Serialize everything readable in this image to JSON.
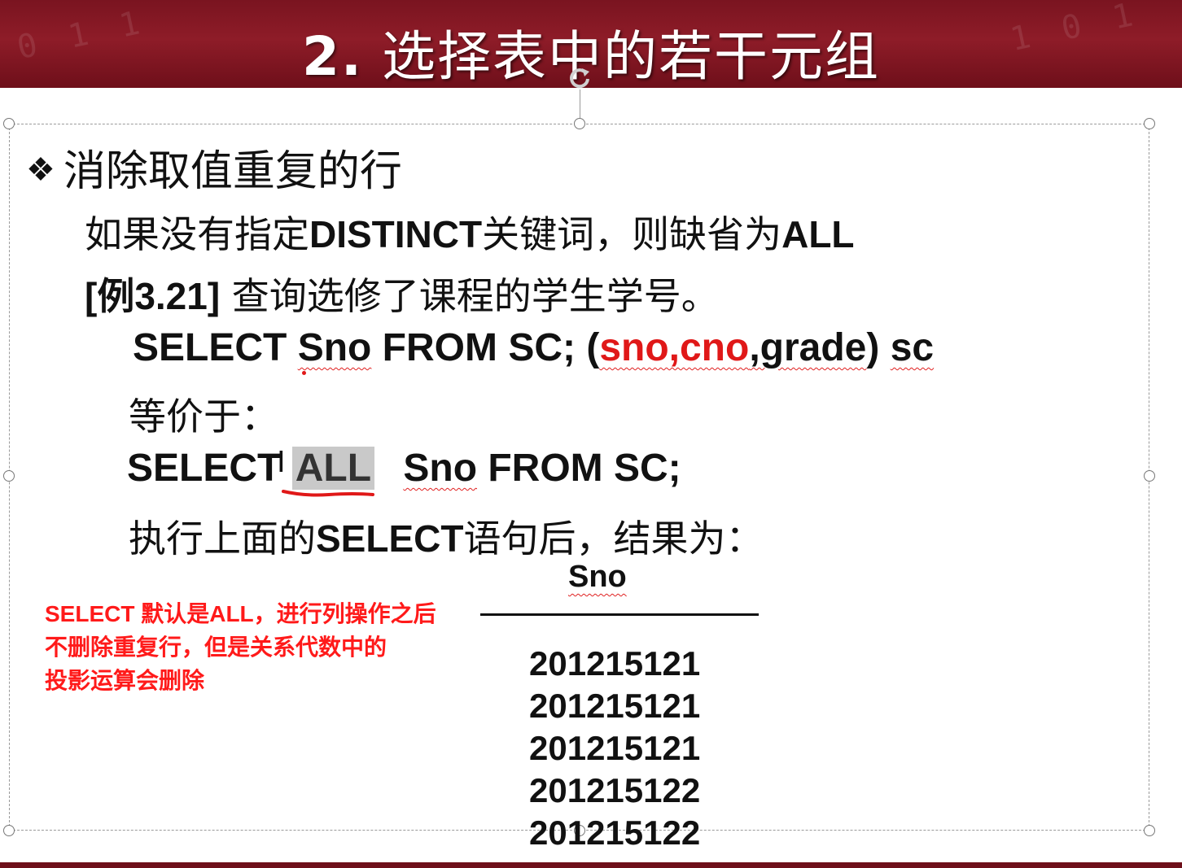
{
  "slide": {
    "title_number": "2.",
    "title_text": "选择表中的若干元组",
    "bullet_symbol": "❖",
    "bullet_heading": "消除取值重复的行",
    "line2": {
      "part1": "如果没有指定",
      "kw1": "DISTINCT",
      "part2": "关键词，则缺省为",
      "kw2": "ALL"
    },
    "line3": {
      "label": "[例3.21]",
      "text": "  查询选修了课程的学生学号。"
    },
    "code1": {
      "select": "SELECT ",
      "sno": "Sno",
      "from": "   FROM SC; (",
      "sno_cno": "sno,cno",
      "grade": ",grade",
      "close": ") ",
      "sc": "sc"
    },
    "equiv": "等价于：",
    "code2": {
      "select": "SELECT",
      "all": "ALL",
      "rest_sno": "Sno",
      "rest_from": "  FROM SC;"
    },
    "exec_line": {
      "part1": "执行上面的",
      "kw": "SELECT",
      "part2": "语句后，结果为："
    },
    "result_header": "Sno",
    "result_values": [
      "201215121",
      "201215121",
      "201215121",
      "201215122",
      "201215122"
    ]
  },
  "annotation": {
    "lines": [
      "SELECT 默认是ALL，进行列操作之后",
      "不删除重复行，但是关系代数中的",
      "投影运算会删除"
    ],
    "color": "#ff1a1a"
  },
  "colors": {
    "header_bg": "#8e1c28",
    "title_text": "#ffffff",
    "highlight": "#c9c9c9",
    "squiggle": "#e02020",
    "red_text": "#e01818"
  }
}
